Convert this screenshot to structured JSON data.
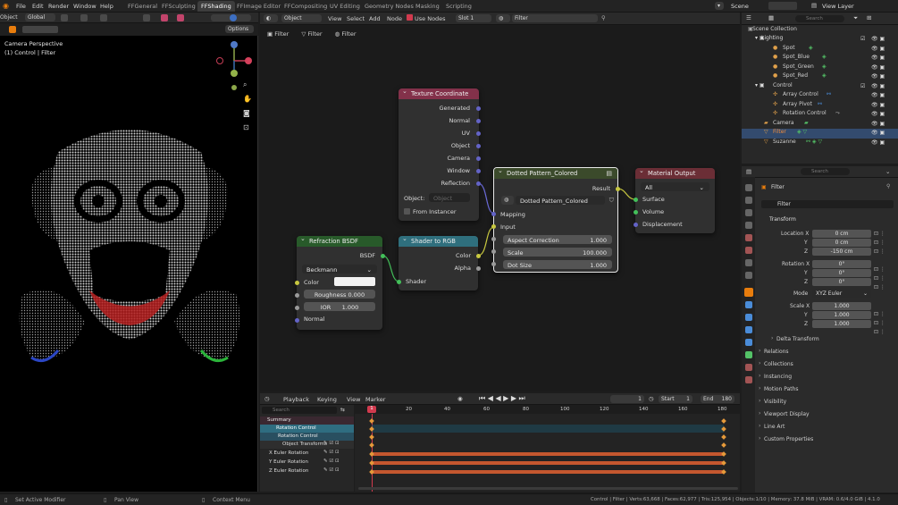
{
  "menu": {
    "items": [
      "File",
      "Edit",
      "Render",
      "Window",
      "Help"
    ]
  },
  "workspaces": [
    "FFGeneral",
    "FFSculpting",
    "FFShading",
    "FFImage Editor",
    "FFCompositing",
    "UV Editing",
    "Geometry Nodes",
    "Masking",
    "Scripting"
  ],
  "active_workspace": "FFShading",
  "scene": {
    "name": "Scene",
    "view_layer": "View Layer"
  },
  "viewport": {
    "mode_label": "Object",
    "orientation": "Global",
    "perspective": "Camera Perspective",
    "object_label": "(1) Control | Filter",
    "options": "Options"
  },
  "node_header": {
    "mode": "Object",
    "menus": [
      "View",
      "Select",
      "Add",
      "Node"
    ],
    "use_nodes": "Use Nodes",
    "slot": "Slot 1",
    "material": "Filter",
    "breadcrumbs": [
      "Filter",
      "Filter",
      "Filter"
    ]
  },
  "nodes": {
    "texcoord": {
      "title": "Texture Coordinate",
      "outputs": [
        "Generated",
        "Normal",
        "UV",
        "Object",
        "Camera",
        "Window",
        "Reflection"
      ],
      "object_label": "Object:",
      "object_placeholder": "Object",
      "from_instancer": "From Instancer"
    },
    "dotted": {
      "title": "Dotted Pattern_Colored",
      "result": "Result",
      "group": "Dotted Pattern_Colored",
      "mapping": "Mapping",
      "input": "Input",
      "fields": [
        {
          "label": "Aspect Correction",
          "value": "1.000"
        },
        {
          "label": "Scale",
          "value": "100.000"
        },
        {
          "label": "Dot Size",
          "value": "1.000"
        }
      ]
    },
    "matout": {
      "title": "Material Output",
      "target": "All",
      "inputs": [
        "Surface",
        "Volume",
        "Displacement"
      ]
    },
    "refraction": {
      "title": "Refraction BSDF",
      "output": "BSDF",
      "distribution": "Beckmann",
      "color": "Color",
      "roughness_label": "Roughness",
      "roughness": "0.000",
      "ior_label": "IOR",
      "ior": "1.000",
      "normal": "Normal"
    },
    "shader2rgb": {
      "title": "Shader to RGB",
      "color": "Color",
      "alpha": "Alpha",
      "shader": "Shader"
    }
  },
  "timeline": {
    "menus": [
      "Playback",
      "Keying",
      "View",
      "Marker"
    ],
    "current_frame": "1",
    "start_label": "Start",
    "start": "1",
    "end_label": "End",
    "end": "180",
    "ticks": [
      "20",
      "40",
      "60",
      "80",
      "100",
      "120",
      "140",
      "160",
      "180"
    ],
    "cursor": "1",
    "search_placeholder": "Search",
    "channels": [
      {
        "label": "Summary"
      },
      {
        "label": "Rotation Control"
      },
      {
        "label": "Rotation Control"
      },
      {
        "label": "Object Transforms"
      },
      {
        "label": "X Euler Rotation"
      },
      {
        "label": "Y Euler Rotation"
      },
      {
        "label": "Z Euler Rotation"
      }
    ]
  },
  "outliner": {
    "title": "Scene Collection",
    "search_placeholder": "Search",
    "rows": [
      {
        "label": "Lighting"
      },
      {
        "label": "Spot"
      },
      {
        "label": "Spot_Blue"
      },
      {
        "label": "Spot_Green"
      },
      {
        "label": "Spot_Red"
      },
      {
        "label": "Control"
      },
      {
        "label": "Array Control"
      },
      {
        "label": "Array Pivot"
      },
      {
        "label": "Rotation Control"
      },
      {
        "label": "Camera"
      },
      {
        "label": "Filter"
      },
      {
        "label": "Suzanne"
      }
    ]
  },
  "properties": {
    "search_placeholder": "Search",
    "object": "Filter",
    "name_field": "Filter",
    "transform": "Transform",
    "location_label": "Location X",
    "loc": [
      "0 cm",
      "0 cm",
      "-150 cm"
    ],
    "rotation_label": "Rotation X",
    "rot": [
      "0°",
      "0°",
      "0°"
    ],
    "mode_label": "Mode",
    "mode": "XYZ Euler",
    "scale_label": "Scale X",
    "scale": [
      "1.000",
      "1.000",
      "1.000"
    ],
    "delta": "Delta Transform",
    "sections": [
      "Relations",
      "Collections",
      "Instancing",
      "Motion Paths",
      "Visibility",
      "Viewport Display",
      "Line Art",
      "Custom Properties"
    ]
  },
  "status": {
    "left1": "Set Active Modifier",
    "left2": "Pan View",
    "left3": "Context Menu",
    "right": "Control | Filter | Verts:63,668 | Faces:62,977 | Tris:125,954 | Objects:1/10 | Memory: 37.8 MiB | VRAM: 0.6/4.0 GiB | 4.1.0"
  },
  "colors": {
    "accent": "#3d6fc2",
    "orange": "#e87d0d",
    "texcoord_header": "#83314a",
    "dotted_header": "#3b4a2b",
    "matout_header": "#6b2e36",
    "refraction_header": "#285a2a",
    "shader2rgb_header": "#2f6f7d"
  }
}
